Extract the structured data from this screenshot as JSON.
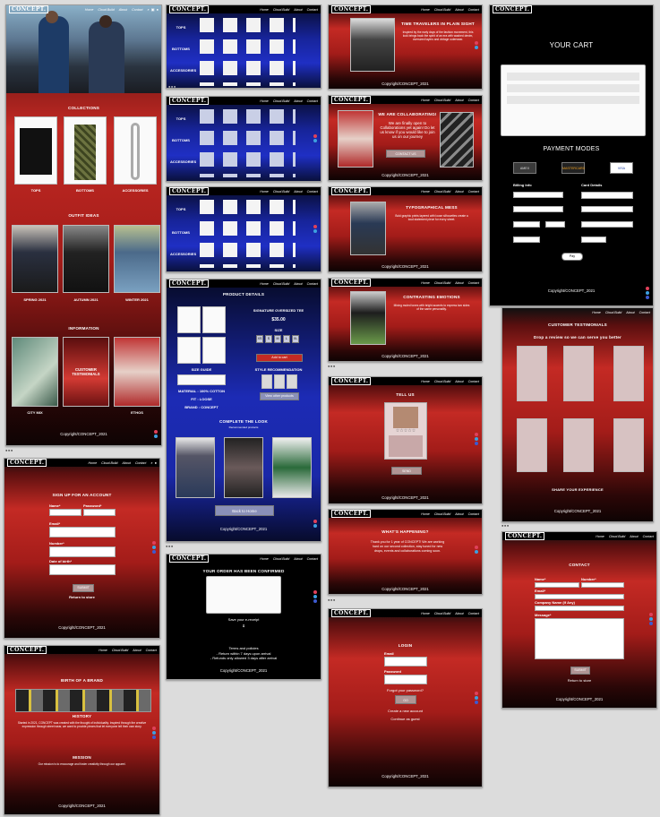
{
  "brand": "CONCEPT.",
  "nav": [
    "Home",
    "Cloud.Build",
    "About",
    "Contact"
  ],
  "copyright": "Copyright/CONCEPT_2021",
  "colors": {
    "accent_red": "#c42a24",
    "deep_blue": "#1f2fc4",
    "bg": "#dcdcdc"
  },
  "home": {
    "collections_title": "COLLECTIONS",
    "categories": [
      "TOPS",
      "BOTTOMS",
      "ACCESSORIES"
    ],
    "outfits_title": "OUTFIT IDEAS",
    "seasons": [
      "SPRING 2021",
      "AUTUMN 2021",
      "WINTER 2021"
    ],
    "more_title": "INFORMATION",
    "info_items": [
      "CITY MIX",
      "CUSTOMER TESTIMONIALS",
      "ETHOS"
    ]
  },
  "catalog": {
    "rows": [
      "TOPS",
      "BOTTOMS",
      "ACCESSORIES"
    ]
  },
  "product": {
    "title": "PRODUCT DETAILS",
    "name": "SIGNATURE OVERSIZED TEE",
    "price": "$35.00",
    "size_label": "SIZE",
    "sizes": [
      "XS",
      "S",
      "M",
      "L",
      "XL"
    ],
    "add_cart": "Add to cart",
    "size_guide": "SIZE GUIDE",
    "style_rec": "STYLE RECOMMENDATION",
    "view_other": "View other products",
    "material": "MATERIAL : 100% COTTON",
    "fit": "FIT : LOOSE",
    "origin": "BRAND : CONCEPT",
    "complete_title": "COMPLETE THE LOOK",
    "complete_sub": "Recommended products",
    "back": "Back to Home"
  },
  "order": {
    "title": "YOUR ORDER HAS BEEN CONFIRMED",
    "receipt": "Save your e-receipt",
    "terms_title": "Terms and policies",
    "terms": [
      "- Return within 7 days upon arrival",
      "- Refunds only allowed 3 days after arrival"
    ]
  },
  "blog": {
    "sections": [
      {
        "title": "TIME TRAVELERS IN PLAIN SIGHT",
        "text": "Inspired by the early days of the fashion movement, this look brings back the spirit of an era with washed denim, oversized layers and vintage outerwear."
      },
      {
        "title": "WE ARE COLLABORATING!",
        "text": "We are finally open to Collaborations yet again! Do let us know if you would like to join us on our journey",
        "button": "CONTACT US"
      },
      {
        "title": "TYPOGRAPHICAL MESS",
        "text": "Bold graphic prints layered with loose silhouettes create a loud statement piece for every street."
      },
      {
        "title": "CONTRASTING EMOTIONS",
        "text": "Mixing muted tones with bright accents to express two sides of the same personality."
      },
      {
        "title": "TELL US",
        "button": "SEND"
      },
      {
        "title": "WHAT'S HAPPENING?",
        "text": "Thank you for 1 year of CONCEPT! We are working hard on our second collection, stay tuned for new drops, events and collaborations coming soon."
      }
    ]
  },
  "login": {
    "title": "LOGIN",
    "email": "Email",
    "password": "Password",
    "forgot": "Forgot your password?",
    "button": "GO",
    "create": "Create a new account",
    "guest": "Continue as guest"
  },
  "cart": {
    "title": "YOUR CART",
    "payment_title": "PAYMENT MODES",
    "cards": [
      "AMEX",
      "MASTERCARD",
      "VISA"
    ],
    "billing": "Billing Info",
    "card_info": "Card Details",
    "pay_button": "Pay"
  },
  "testimonials": {
    "title": "CUSTOMER TESTIMONIALS",
    "subtitle": "Drop a review so we can serve you better",
    "share": "SHARE YOUR EXPERIENCE"
  },
  "signup": {
    "title": "SIGN UP FOR AN ACCOUNT",
    "name": "Name*",
    "password": "Password*",
    "email": "Email*",
    "number": "Number*",
    "dob": "Date of birth*",
    "submit": "SUBMIT",
    "return": "Return to store"
  },
  "about": {
    "brand_title": "BIRTH OF A BRAND",
    "history_title": "HISTORY",
    "history_text": "Started in 2021, CONCEPT was created with the thought of individuality. Inspired through the creative expression through street wear, we want to provide pieces that let everyone tell their own story.",
    "mission_title": "MISSION",
    "mission_text": "Our mission is to encourage and foster creativity through our apparel."
  },
  "contact": {
    "title": "CONTACT",
    "name": "Name*",
    "number": "Number*",
    "email": "Email*",
    "company": "Company Name (If Any)",
    "message": "Message*",
    "submit": "SUBMIT",
    "return": "Return to store"
  }
}
